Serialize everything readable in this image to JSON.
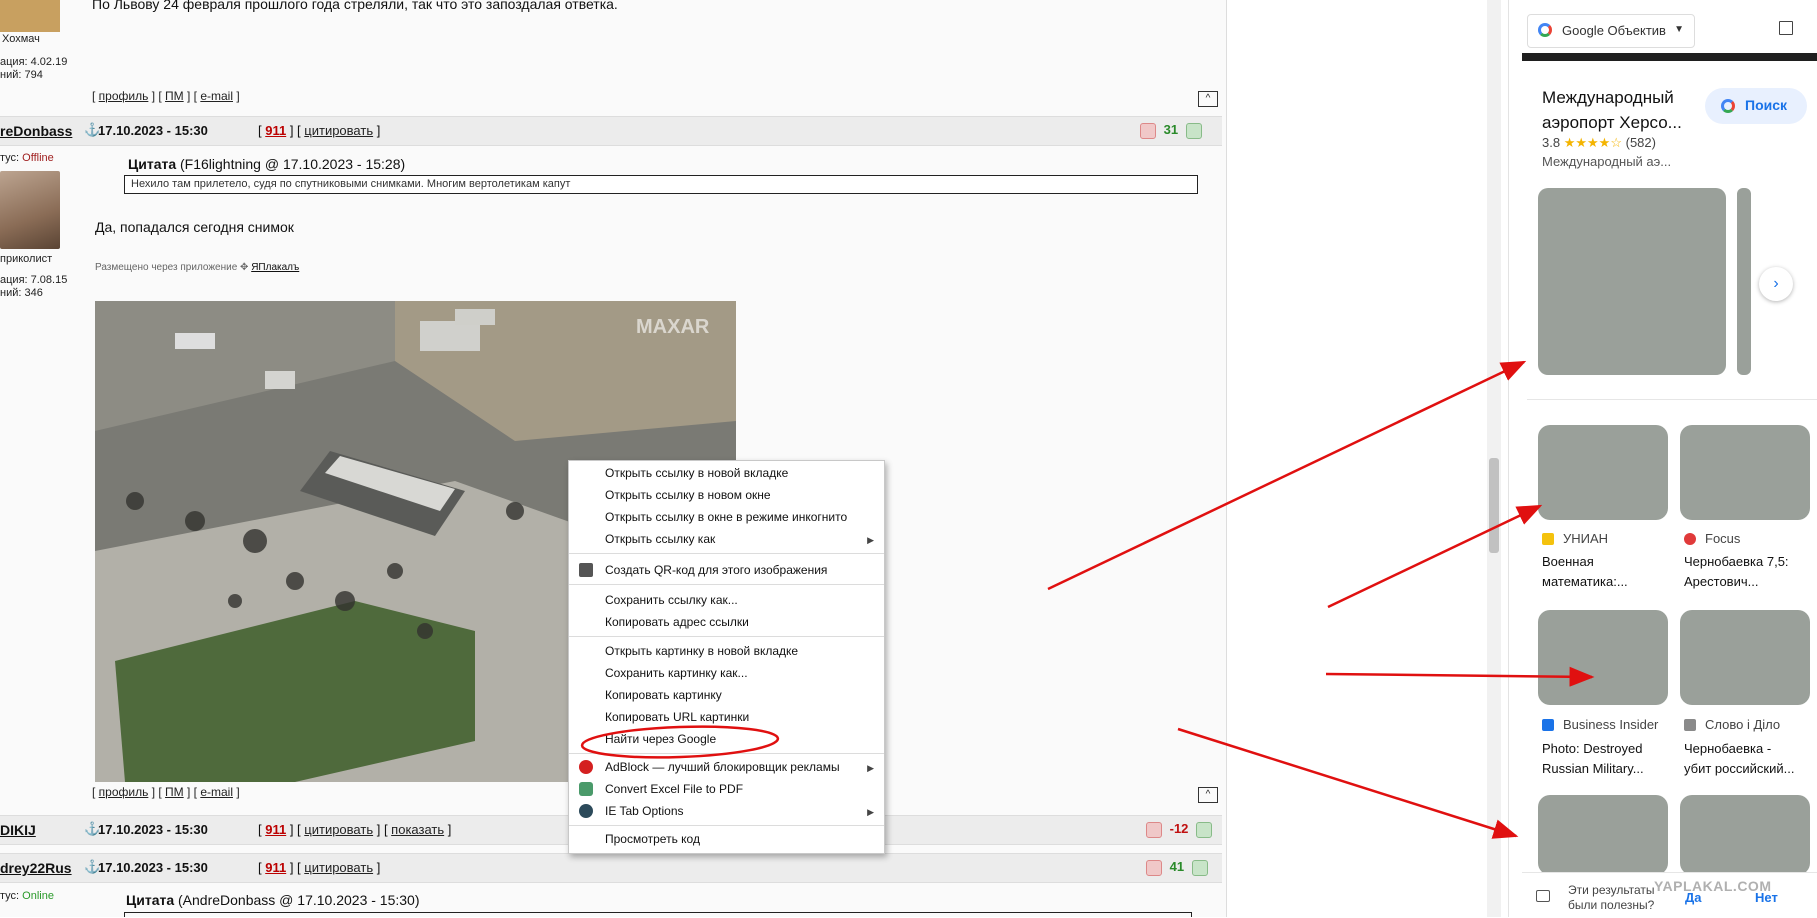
{
  "forum": {
    "top_post_text": "По Львову 24 февраля прошлого года стреляли, так что это запоздалая ответка.",
    "user1": {
      "name": "Хохмач",
      "reg": "ация: 4.02.19",
      "posts": "ний: 794"
    },
    "footer_links": [
      "профиль",
      "ПМ",
      "e-mail"
    ],
    "up_label": "^",
    "post1": {
      "nick": "reDonbass",
      "anchor": "⚓",
      "date": "17.10.2023 - 15:30",
      "num": "911",
      "cite": "цитировать",
      "rating": "31",
      "status_label": "тус:",
      "status": "Offline",
      "title": "приколист",
      "reg": "ация: 7.08.15",
      "posts": "ний: 346",
      "quote_label": "Цитата",
      "quote_meta": "(F16lightning @ 17.10.2023 - 15:28)",
      "quote_text": "Нехило там прилетело, судя по спутниковыми снимками. Многим вертолетикам капут",
      "text": "Да, попадался сегодня снимок",
      "via": "Размещено через приложение",
      "app": "ЯПлакалъ",
      "watermark": "MAXAR"
    },
    "post2": {
      "nick": "DIKIJ",
      "date": "17.10.2023 - 15:30",
      "num": "911",
      "cite": "цитировать",
      "show": "показать",
      "rating": "-12"
    },
    "post3": {
      "nick": "drey22Rus",
      "date": "17.10.2023 - 15:30",
      "num": "911",
      "cite": "цитировать",
      "rating": "41",
      "status_label": "тус:",
      "status": "Online",
      "quote_label": "Цитата",
      "quote_meta": "(AndreDonbass @ 17.10.2023 - 15:30)"
    }
  },
  "context_menu": {
    "items": [
      "Открыть ссылку в новой вкладке",
      "Открыть ссылку в новом окне",
      "Открыть ссылку в окне в режиме инкогнито",
      "Открыть ссылку как",
      "Создать QR-код для этого изображения",
      "Сохранить ссылку как...",
      "Копировать адрес ссылки",
      "Открыть картинку в новой вкладке",
      "Сохранить картинку как...",
      "Копировать картинку",
      "Копировать URL картинки",
      "Найти через Google",
      "AdBlock — лучший блокировщик рекламы",
      "Convert Excel File to PDF",
      "IE Tab Options",
      "Просмотреть код"
    ]
  },
  "lens": {
    "header_title": "Google Объектив",
    "place_title_1": "Международный",
    "place_title_2": "аэропорт Херсо...",
    "rating": "3.8",
    "stars": "★★★★☆",
    "reviews": "(582)",
    "place_sub": "Международный аэ...",
    "search_btn": "Поиск",
    "results": [
      {
        "source": "УНИАН",
        "caption1": "Военная",
        "caption2": "математика:..."
      },
      {
        "source": "Focus",
        "caption1": "Чернобаевка 7,5:",
        "caption2": "Арестович..."
      },
      {
        "source": "Business Insider",
        "caption1": "Photo: Destroyed",
        "caption2": "Russian Military..."
      },
      {
        "source": "Слово і Діло",
        "caption1": "Чернобаевка -",
        "caption2": "убит российский..."
      }
    ],
    "feedback_q1": "Эти результаты",
    "feedback_q2": "были полезны?",
    "yes": "Да",
    "no": "Нет",
    "site_watermark": "YAPLAKAL.COM"
  },
  "colors": {
    "annotation": "#e01010",
    "lens_blue": "#1a73e8",
    "offline": "#a02020",
    "online": "#2a9a2a"
  }
}
